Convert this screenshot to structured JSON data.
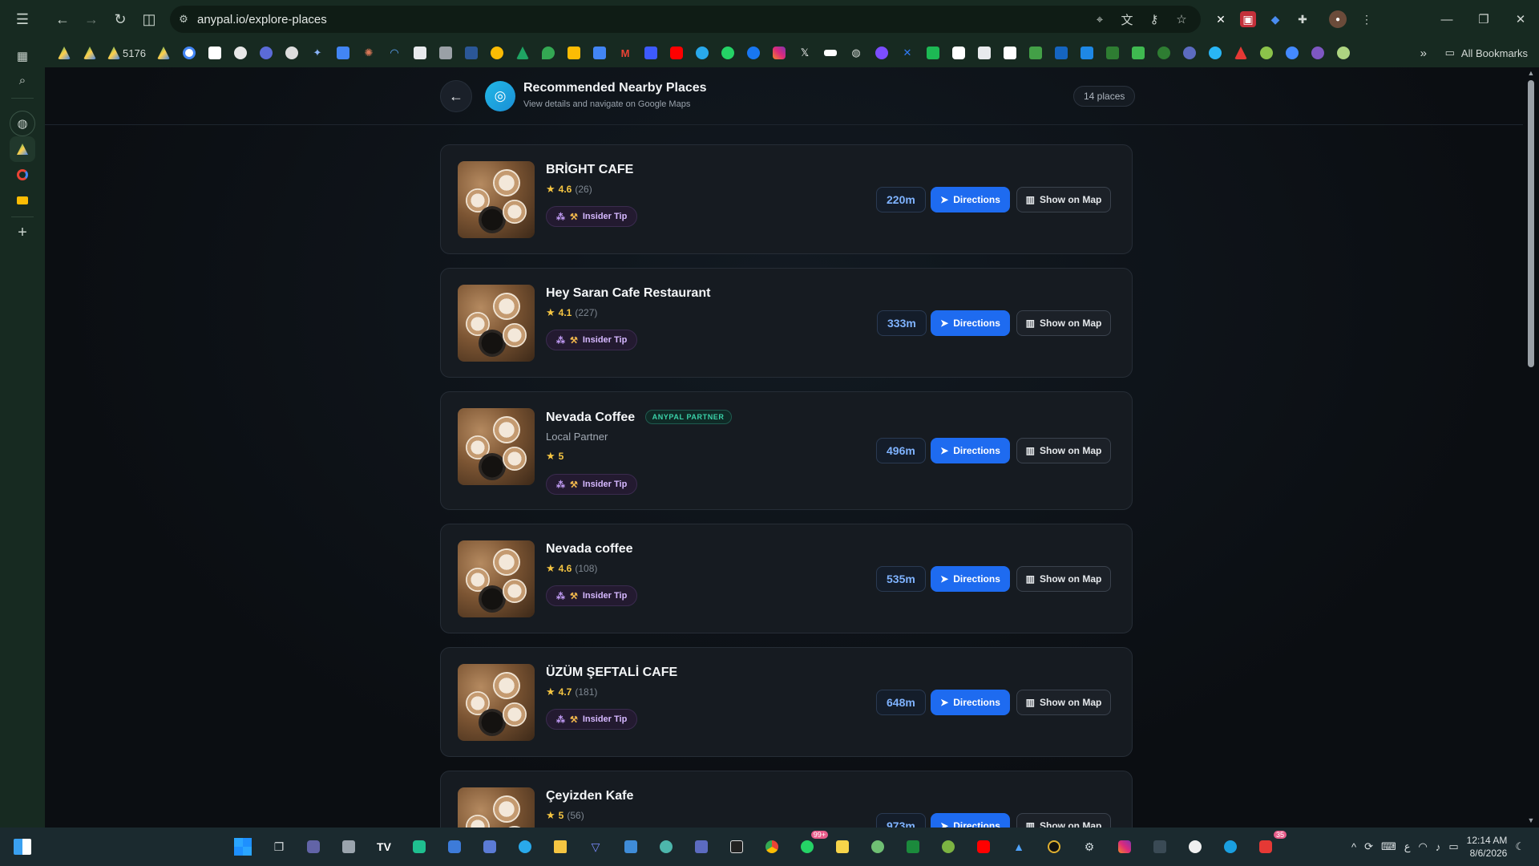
{
  "browser": {
    "url": "anypal.io/explore-places",
    "bookmark_count_label": "5176",
    "all_bookmarks_label": "All Bookmarks"
  },
  "header": {
    "title": "Recommended Nearby Places",
    "subtitle": "View details and navigate on Google Maps",
    "count_label": "14 places"
  },
  "buttons": {
    "directions_label": "Directions",
    "show_map_label": "Show on Map",
    "insider_tip_label": "Insider Tip"
  },
  "places": [
    {
      "name": "BRİGHT CAFE",
      "rating": "4.6",
      "reviews": "(26)",
      "distance": "220m"
    },
    {
      "name": "Hey Saran Cafe Restaurant",
      "rating": "4.1",
      "reviews": "(227)",
      "distance": "333m"
    },
    {
      "name": "Nevada Coffee",
      "badge": "ANYPAL PARTNER",
      "subtitle": "Local Partner",
      "rating": "5",
      "distance": "496m"
    },
    {
      "name": "Nevada coffee",
      "rating": "4.6",
      "reviews": "(108)",
      "distance": "535m"
    },
    {
      "name": "ÜZÜM ŞEFTALİ CAFE",
      "rating": "4.7",
      "reviews": "(181)",
      "distance": "648m"
    },
    {
      "name": "Çeyizden Kafe",
      "rating": "5",
      "reviews": "(56)",
      "distance": "973m"
    }
  ],
  "taskbar": {
    "whatsapp_badge": "99+",
    "app_badge": "35",
    "time": "12:14 AM",
    "date": "8/6/2026"
  },
  "colors": {
    "accent": "#1e6bf0",
    "partner": "#3ad1a8",
    "star": "#f5c542",
    "chrome": "#172a21"
  }
}
